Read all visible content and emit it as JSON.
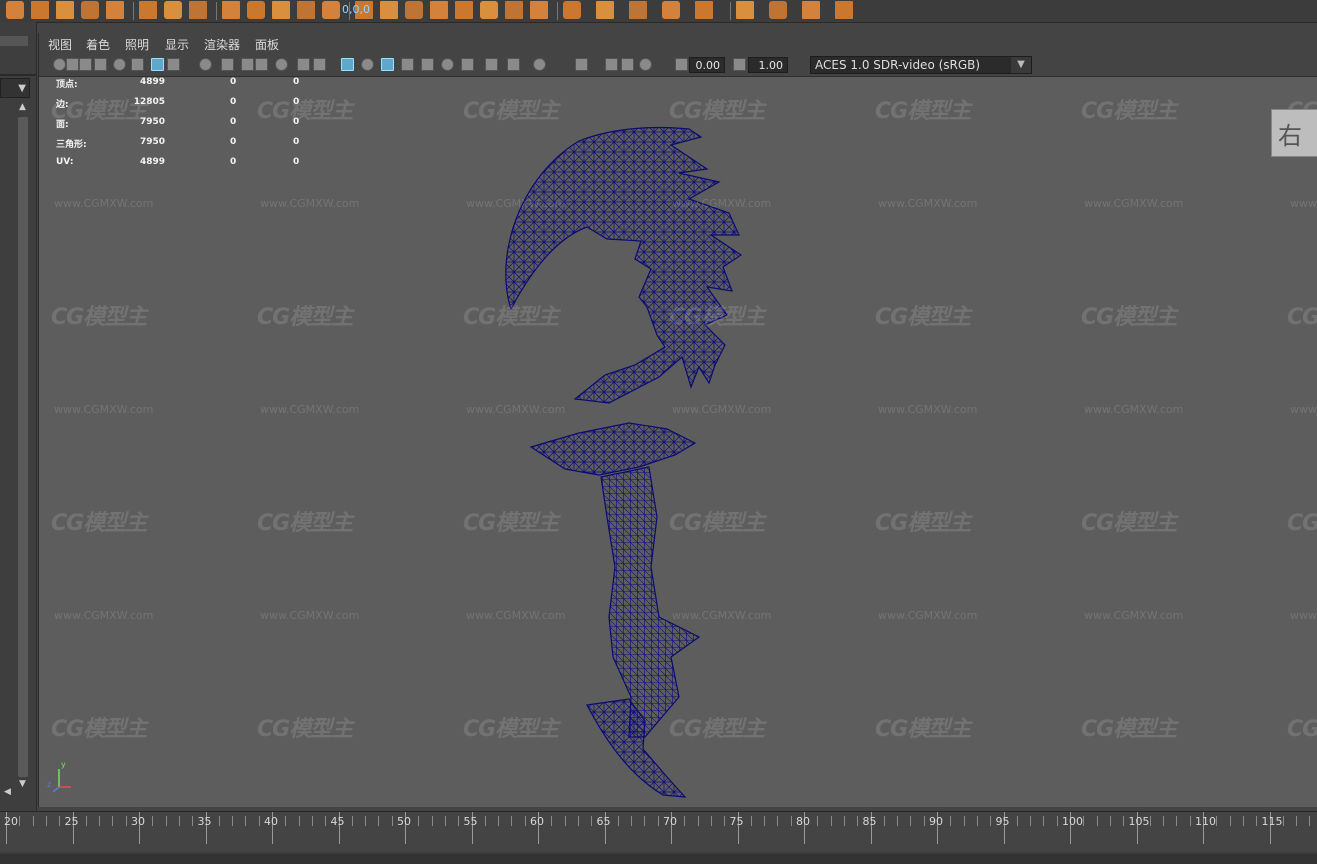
{
  "menu": [
    "视图",
    "着色",
    "照明",
    "显示",
    "渲染器",
    "面板"
  ],
  "shelf_icons": [
    "poly-sphere-icon",
    "curve-icon",
    "text-tool-icon",
    "svg-icon",
    "uv-grid-icon",
    "snap-icon",
    "move-pivot-icon",
    "coordinate-icon",
    "select-object-icon",
    "bevel-icon",
    "extrude-icon",
    "bridge-icon",
    "combine-icon",
    "separate-icon",
    "mirror-icon",
    "boolean-icon",
    "smooth-icon",
    "reduce-icon",
    "cleanup-icon",
    "triangulate-icon",
    "quadrangulate-icon",
    "fill-hole-icon",
    "append-icon",
    "multicut-icon",
    "target-weld-icon",
    "connect-icon",
    "crease-icon",
    "bevel-tool-icon",
    "merge-icon",
    "uv-icon"
  ],
  "toolbar": {
    "near_clip_value": "0.00",
    "far_clip_value": "1.00",
    "color_management": "ACES 1.0 SDR-video (sRGB)",
    "coord_label": "0,0,0"
  },
  "hud": {
    "rows": [
      {
        "label": "顶点:",
        "v1": "4899",
        "v2": "0",
        "v3": "0"
      },
      {
        "label": "边:",
        "v1": "12805",
        "v2": "0",
        "v3": "0"
      },
      {
        "label": "面:",
        "v1": "7950",
        "v2": "0",
        "v3": "0"
      },
      {
        "label": "三角形:",
        "v1": "7950",
        "v2": "0",
        "v3": "0"
      },
      {
        "label": "UV:",
        "v1": "4899",
        "v2": "0",
        "v3": "0"
      }
    ]
  },
  "watermark": {
    "logo": "CG模型主",
    "url": "www.CGMXW.com"
  },
  "camera": "persp",
  "viewcube_face": "右",
  "axis": {
    "y": "y",
    "z": "z",
    "x": "x"
  },
  "colors": {
    "wireframe": "#0b0b72",
    "panel_bg": "#5d5d5d"
  },
  "timeline": {
    "labels": [
      "20",
      "25",
      "30",
      "35",
      "40",
      "45",
      "50",
      "55",
      "60",
      "65",
      "70",
      "75",
      "80",
      "85",
      "90",
      "95",
      "100",
      "105",
      "110",
      "115"
    ]
  }
}
